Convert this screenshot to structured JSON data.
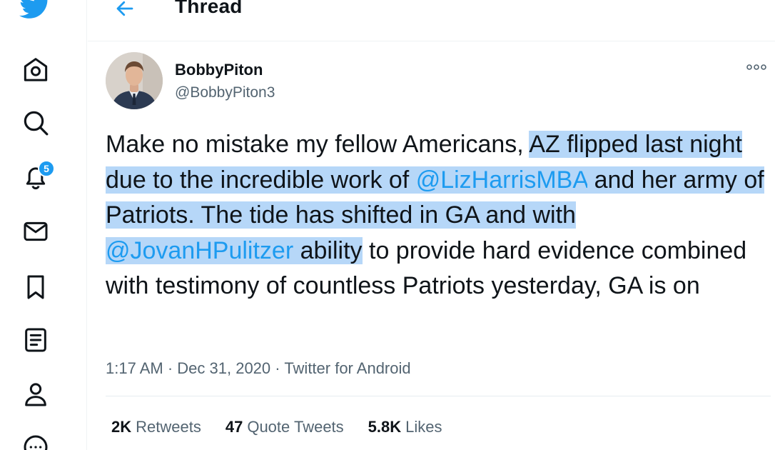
{
  "colors": {
    "accent": "#1d9bf0",
    "text": "#0f1419",
    "muted": "#536471",
    "highlight": "#b6d7f8"
  },
  "nav": {
    "items": [
      {
        "name": "home",
        "icon": "home-icon"
      },
      {
        "name": "explore",
        "icon": "search-icon"
      },
      {
        "name": "notifications",
        "icon": "bell-icon",
        "badge": "5"
      },
      {
        "name": "messages",
        "icon": "mail-icon"
      },
      {
        "name": "bookmarks",
        "icon": "bookmark-icon"
      },
      {
        "name": "lists",
        "icon": "list-icon"
      },
      {
        "name": "profile",
        "icon": "person-icon"
      },
      {
        "name": "more",
        "icon": "more-circle-icon"
      }
    ]
  },
  "header": {
    "title": "Thread"
  },
  "tweet": {
    "author_name": "BobbyPiton",
    "author_handle": "@BobbyPiton3",
    "text": {
      "part1": "Make no mistake my fellow Americans, ",
      "part2": "AZ flipped last night due to the  incredible work of ",
      "mention1": "@LizHarrisMBA",
      "part3": " and her army of Patriots. The tide has shifted in GA and with ",
      "mention2": "@JovanHPulitzer",
      "part4": " ability",
      "part5": " to provide hard evidence combined with testimony of countless Patriots yesterday, GA is on"
    },
    "time": "1:17 AM",
    "date": "Dec 31, 2020",
    "source": "Twitter for Android",
    "separator": " · ",
    "stats": {
      "retweets_count": "2K",
      "retweets_label": "Retweets",
      "quotes_count": "47",
      "quotes_label": "Quote Tweets",
      "likes_count": "5.8K",
      "likes_label": "Likes"
    }
  }
}
